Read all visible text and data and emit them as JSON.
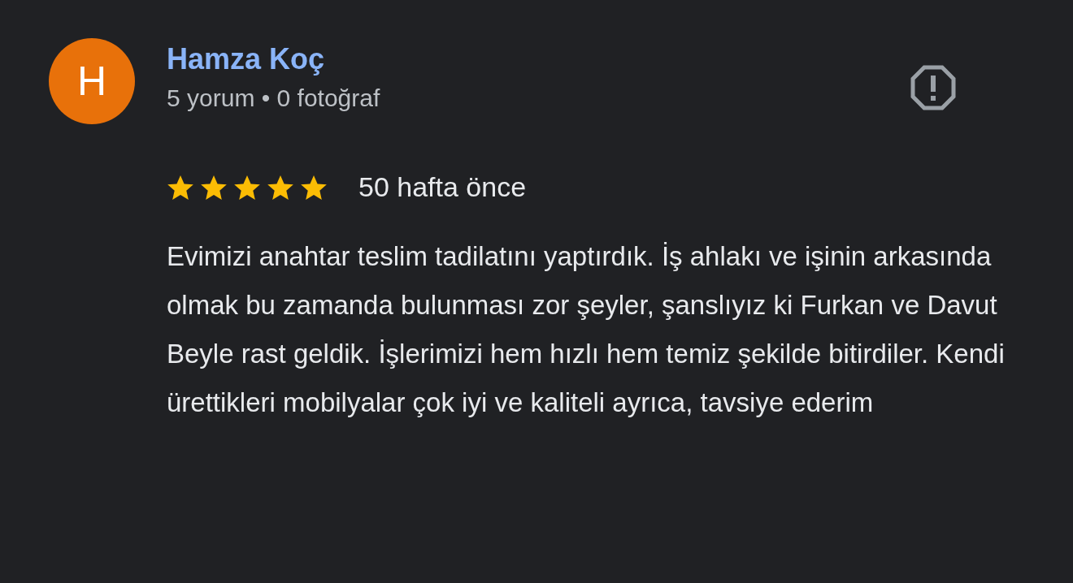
{
  "review": {
    "avatar_letter": "H",
    "author": "Hamza Koç",
    "meta": "5 yorum • 0 fotoğraf",
    "stars": 5,
    "time": "50 hafta önce",
    "text": "Evimizi anahtar teslim tadilatını yaptırdık. İş ahlakı ve işinin arkasında olmak bu zamanda bulunması zor şeyler, şanslıyız ki Furkan ve Davut Beyle rast geldik. İşlerimizi hem hızlı hem temiz şekilde bitirdiler. Kendi ürettikleri mobilyalar çok iyi ve kaliteli ayrıca, tavsiye ederim"
  }
}
